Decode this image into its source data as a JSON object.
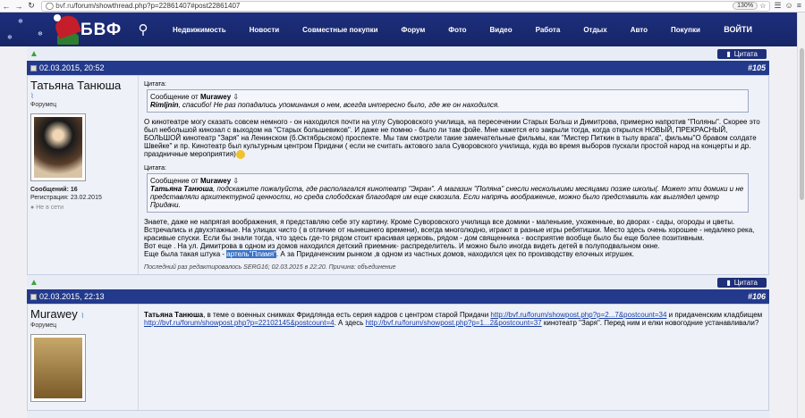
{
  "browser": {
    "url_host": "bvf.ru",
    "url_path": "/forum/showthread.php?p=22861407#post22861407",
    "zoom": "130%"
  },
  "site": {
    "logo_text": "БВФ",
    "nav": [
      "Недвижимость",
      "Новости",
      "Совместные покупки",
      "Форум",
      "Фото",
      "Видео",
      "Работа",
      "Отдых",
      "Авто",
      "Покупки"
    ],
    "login": "ВОЙТИ"
  },
  "cite_label": "Цитата",
  "post1": {
    "date": "02.03.2015, 20:52",
    "number": "#105",
    "author": "Татьяна Танюша",
    "role": "Форумец",
    "messages_label": "Сообщений:",
    "messages": "16",
    "reg_label": "Регистрация:",
    "reg": "23.02.2015",
    "offline": "Не в сети",
    "q1_label": "Цитата:",
    "q1_from": "Сообщение от",
    "q1_user": "Murawey",
    "q1_name": "Rimljnin",
    "q1_text": ", спасибо! Не раз попадались упоминания о нем, всегда интересно было, где же он находился.",
    "p1": "О кинотеатре могу сказать совсем немного - он находился почти на углу Суворовского училища, на пересечении Старых Больш и Димитрова, примерно напротив \"Поляны\". Скорее это был небольшой кинозал с выходом на \"Старых большевиков\". И даже не помню - было ли там фойе. Мне кажется его закрыли тогда, когда открылся НОВЫЙ, ПРЕКРАСНЫЙ, БОЛЬШОЙ кинотеатр \"Заря\" на Ленинском (б.Октябрьском) проспекте. Мы там смотрели такие замечательные фильмы, как \"Мистер Питкин в тылу врага\", фильмы\"О бравом солдате Швейке\" и пр. Кинотеатр был культурным центром Придачи ( если не считать актового зала Суворовского училища, куда во время выборов пускали простой народ на концерты и др. праздничные мероприятия)",
    "q2_label": "Цитата:",
    "q2_from": "Сообщение от",
    "q2_user": "Murawey",
    "q2_name": "Татьяна Танюша",
    "q2_text": ", подскажите пожалуйста, где располагался кинотеатр \"Экран\". А магазин \"Поляна\" снесли несколькими месяцами позже школы(. Может эти домики и не представляли архитектурной ценности, но среда слободская благодаря им еще сквозила. Если напрячь воображение, можно было представить как выглядел центр Придачи.",
    "p2a": "Знаете, даже не напрягая воображения, я представляю себе эту картину. Кроме Суворовского училища все домики - маленькие, ухоженные, во дворах - сады, огороды и цветы. Встречались и двухэтажные. На улицах чисто ( в отличие от нынешнего времени), всегда многолюдно, играют в разные игры ребятишки. Место здесь очень хорошее - недалеко река, красивые спуски. Если бы знали тогда, что здесь где-то рядом стоит красивая церковь, рядом - дом священника - восприятие вообще было бы еще более позитивным.",
    "p2b": "Вот еще . На ул. Димитрова в одном из домов находился детский приемник- распределитель. И можно было иногда видеть детей в полуподвальном окне.",
    "p2c_pre": "Еще была такая штука - ",
    "p2c_hl": "артель\"Пламя\"",
    "p2c_post": ". А за Придаченским рынком ,в одном из частных домов, находился цех по производству елочных игрушек.",
    "edited": "Последний раз редактировалось SERG16; 02.03.2015 в 22:20. Причина: объединение"
  },
  "post2": {
    "date": "02.03.2015, 22:13",
    "number": "#106",
    "author": "Murawey",
    "role": "Форумец",
    "t1_name": "Татьяна Танюша",
    "t1": ", в теме о военных снимках Фридлянда есть серия кадров с центром старой Придачи ",
    "l1": "http://bvf.ru/forum/showpost.php?p=2...7&postcount=34",
    "t2": " и придаченским кладбищем ",
    "l2": "http://bvf.ru/forum/showpost.php?p=22102145&postcount=4",
    "t3": ". А здесь ",
    "l3": "http://bvf.ru/forum/showpost.php?p=1...2&postcount=37",
    "t4": " кинотеатр \"Заря\". Перед ним и елки новогодние устанавливали?"
  }
}
